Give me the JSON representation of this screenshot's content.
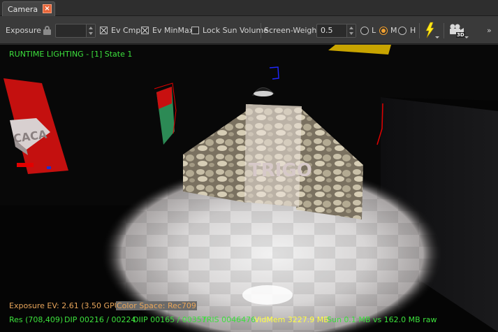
{
  "tab": {
    "label": "Camera",
    "close_icon": "×"
  },
  "toolbar": {
    "exposure_label": "Exposure",
    "exposure_value": "",
    "ev_cmp": {
      "label": "Ev Cmp",
      "checked": true
    },
    "ev_minmax": {
      "label": "Ev MinMax",
      "checked": true
    },
    "lock_sun": {
      "label": "Lock Sun Volume",
      "checked": false
    },
    "screen_weight_label": "Screen-Weight",
    "screen_weight_value": "0.5",
    "lod": {
      "options": [
        "L",
        "M",
        "H"
      ],
      "selected": "M"
    },
    "lighting_icon": "lightning-icon",
    "camera_3d_icon": "camera-3d-icon",
    "overflow_icon": "»",
    "camera_3d_badge": "3D"
  },
  "overlay": {
    "title": "RUNTIME LIGHTING - [1] State 1",
    "exposure": "Exposure EV: 2.61 (3.50 GPU)",
    "color_space": "Color Space: Rec709",
    "stats": {
      "res": "Res (708,409)",
      "dip": "DIP 00216 / 00224",
      "diip": "DIIP 00165 / 00357",
      "tris": "TRIS 0046476",
      "vidmem": "VidMem 3227.9 MB",
      "sun": "Sun 0.1 MB vs 162.0 MB raw"
    },
    "colors": {
      "green": "#3ce03c",
      "orange": "#e8a55a",
      "yellow": "#ffff40"
    }
  },
  "scene": {
    "sign_text_1": "CACA",
    "sign_text_2": "TRIGO"
  }
}
